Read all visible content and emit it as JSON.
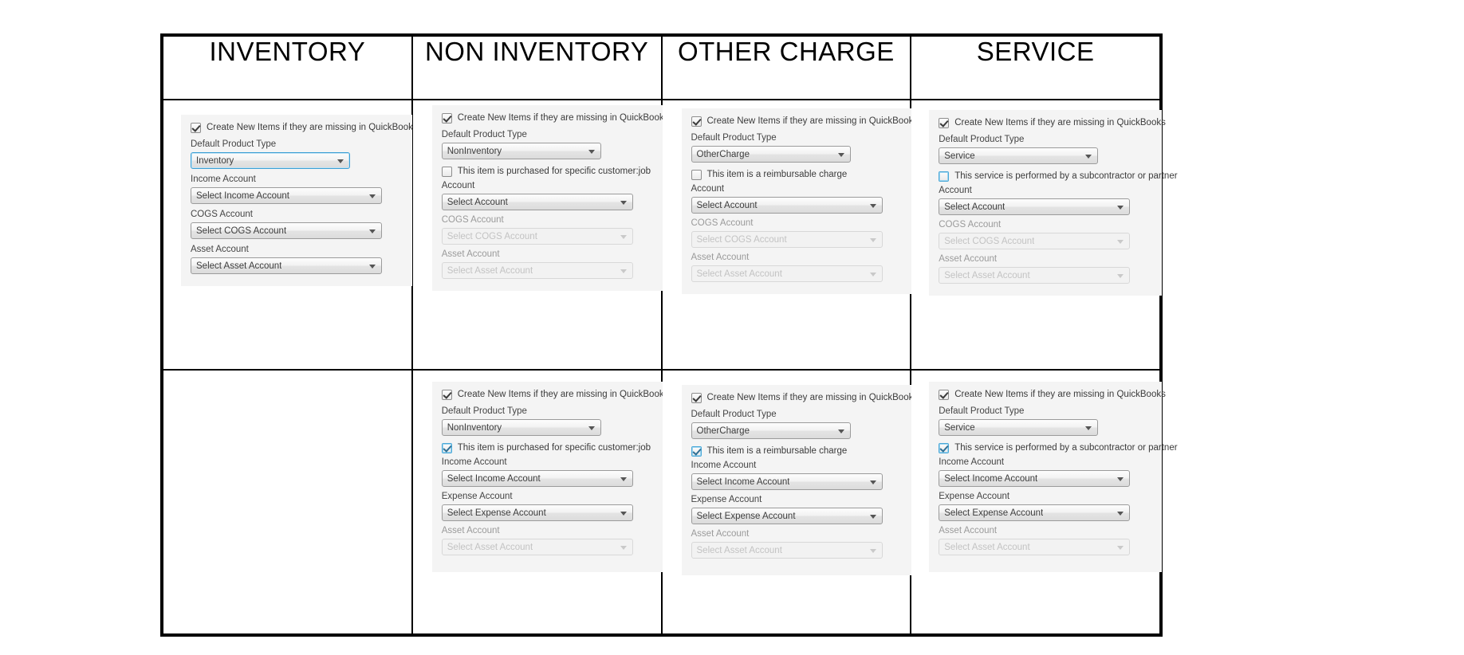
{
  "table": {
    "columns": [
      {
        "header": "INVENTORY"
      },
      {
        "header": "NON INVENTORY"
      },
      {
        "header": "OTHER CHARGE"
      },
      {
        "header": "SERVICE"
      }
    ]
  },
  "labels": {
    "create_new_items": "Create New Items if they are missing in QuickBooks",
    "default_product_type": "Default Product Type",
    "income_account": "Income Account",
    "cogs_account": "COGS Account",
    "asset_account": "Asset Account",
    "account": "Account",
    "expense_account": "Expense Account",
    "purchased_for_customer_job": "This item is purchased for specific customer:job",
    "reimbursable_charge": "This item is a reimbursable charge",
    "performed_by_subcontractor": "This service is performed by a subcontractor or partner"
  },
  "values": {
    "inventory": "Inventory",
    "noninventory": "NonInventory",
    "othercharge": "OtherCharge",
    "service": "Service",
    "select_income_account": "Select Income Account",
    "select_cogs_account": "Select COGS Account",
    "select_asset_account": "Select Asset Account",
    "select_account": "Select Account",
    "select_expense_account": "Select Expense Account"
  },
  "colors": {
    "focus_blue": "#3c9fd4",
    "panel_bg": "#f4f4f4",
    "border_black": "#000000",
    "text": "#3b3b3b",
    "disabled_text": "#c3c3c3"
  },
  "cells": {
    "r1c1": {
      "empty": false,
      "checkbox_create": {
        "label": "Create New Items if they are missing in QuickBooks",
        "checked": true,
        "focused": false
      },
      "fields": [
        {
          "label": "Default Product Type",
          "value": "Inventory",
          "disabled": false,
          "focused": true
        },
        {
          "label": "Income Account",
          "value": "Select Income Account",
          "disabled": false,
          "focused": false
        },
        {
          "label": "COGS Account",
          "value": "Select COGS Account",
          "disabled": false,
          "focused": false
        },
        {
          "label": "Asset Account",
          "value": "Select Asset Account",
          "disabled": false,
          "focused": false
        }
      ]
    },
    "r1c2": {
      "empty": false,
      "checkbox_create": {
        "label": "Create New Items if they are missing in QuickBooks",
        "checked": true,
        "focused": false
      },
      "product_type": {
        "label": "Default Product Type",
        "value": "NonInventory"
      },
      "checkbox_option": {
        "label": "This item is purchased for specific customer:job",
        "checked": false,
        "focused": false
      },
      "fields": [
        {
          "label": "Account",
          "value": "Select Account",
          "disabled": false
        },
        {
          "label": "COGS Account",
          "value": "Select COGS Account",
          "disabled": true
        },
        {
          "label": "Asset Account",
          "value": "Select Asset Account",
          "disabled": true
        }
      ]
    },
    "r1c3": {
      "empty": false,
      "checkbox_create": {
        "label": "Create New Items if they are missing in QuickBooks",
        "checked": true,
        "focused": false
      },
      "product_type": {
        "label": "Default Product Type",
        "value": "OtherCharge"
      },
      "checkbox_option": {
        "label": "This item is a reimbursable charge",
        "checked": false,
        "focused": false
      },
      "fields": [
        {
          "label": "Account",
          "value": "Select Account",
          "disabled": false
        },
        {
          "label": "COGS Account",
          "value": "Select COGS Account",
          "disabled": true
        },
        {
          "label": "Asset Account",
          "value": "Select Asset Account",
          "disabled": true
        }
      ]
    },
    "r1c4": {
      "empty": false,
      "checkbox_create": {
        "label": "Create New Items if they are missing in QuickBooks",
        "checked": true,
        "focused": false
      },
      "product_type": {
        "label": "Default Product Type",
        "value": "Service"
      },
      "checkbox_option": {
        "label": "This service is performed by a subcontractor or partner",
        "checked": false,
        "focused": true
      },
      "fields": [
        {
          "label": "Account",
          "value": "Select Account",
          "disabled": false
        },
        {
          "label": "COGS Account",
          "value": "Select COGS Account",
          "disabled": true
        },
        {
          "label": "Asset Account",
          "value": "Select Asset Account",
          "disabled": true
        }
      ]
    },
    "r2c1": {
      "empty": true
    },
    "r2c2": {
      "empty": false,
      "checkbox_create": {
        "label": "Create New Items if they are missing in QuickBooks",
        "checked": true,
        "focused": false
      },
      "product_type": {
        "label": "Default Product Type",
        "value": "NonInventory"
      },
      "checkbox_option": {
        "label": "This item is purchased for specific customer:job",
        "checked": true,
        "focused": true
      },
      "fields": [
        {
          "label": "Income Account",
          "value": "Select Income Account",
          "disabled": false
        },
        {
          "label": "Expense Account",
          "value": "Select Expense Account",
          "disabled": false
        },
        {
          "label": "Asset Account",
          "value": "Select Asset Account",
          "disabled": true
        }
      ]
    },
    "r2c3": {
      "empty": false,
      "checkbox_create": {
        "label": "Create New Items if they are missing in QuickBooks",
        "checked": true,
        "focused": false
      },
      "product_type": {
        "label": "Default Product Type",
        "value": "OtherCharge"
      },
      "checkbox_option": {
        "label": "This item is a reimbursable charge",
        "checked": true,
        "focused": true
      },
      "fields": [
        {
          "label": "Income Account",
          "value": "Select Income Account",
          "disabled": false
        },
        {
          "label": "Expense Account",
          "value": "Select Expense Account",
          "disabled": false
        },
        {
          "label": "Asset Account",
          "value": "Select Asset Account",
          "disabled": true
        }
      ]
    },
    "r2c4": {
      "empty": false,
      "checkbox_create": {
        "label": "Create New Items if they are missing in QuickBooks",
        "checked": true,
        "focused": false
      },
      "product_type": {
        "label": "Default Product Type",
        "value": "Service"
      },
      "checkbox_option": {
        "label": "This service is performed by a subcontractor or partner",
        "checked": true,
        "focused": true
      },
      "fields": [
        {
          "label": "Income Account",
          "value": "Select Income Account",
          "disabled": false
        },
        {
          "label": "Expense Account",
          "value": "Select Expense Account",
          "disabled": false
        },
        {
          "label": "Asset Account",
          "value": "Select Asset Account",
          "disabled": true
        }
      ]
    }
  }
}
